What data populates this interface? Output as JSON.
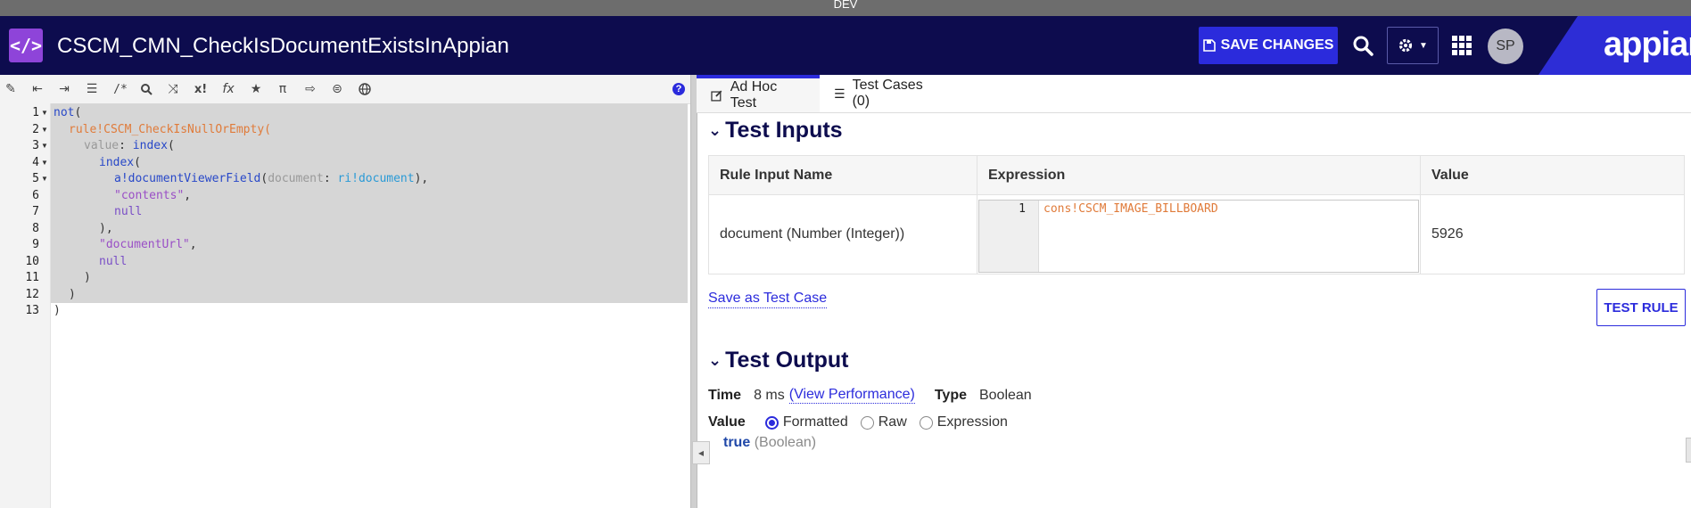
{
  "env": {
    "label": "DEV"
  },
  "header": {
    "title": "CSCM_CMN_CheckIsDocumentExistsInAppian",
    "save_label": "SAVE CHANGES",
    "avatar_initials": "SP",
    "brand": "appian"
  },
  "editor": {
    "toolbar_icons": [
      "format-icon",
      "outdent-icon",
      "indent-icon",
      "list-icon",
      "comment-icon",
      "search-icon",
      "shuffle-icon",
      "variable-icon",
      "function-icon",
      "star-icon",
      "pi-icon",
      "export-icon",
      "search-data-icon",
      "globe-icon"
    ],
    "lines": [
      {
        "n": "1",
        "fold": true
      },
      {
        "n": "2",
        "fold": true
      },
      {
        "n": "3",
        "fold": true
      },
      {
        "n": "4",
        "fold": true
      },
      {
        "n": "5",
        "fold": true
      },
      {
        "n": "6",
        "fold": false
      },
      {
        "n": "7",
        "fold": false
      },
      {
        "n": "8",
        "fold": false
      },
      {
        "n": "9",
        "fold": false
      },
      {
        "n": "10",
        "fold": false
      },
      {
        "n": "11",
        "fold": false
      },
      {
        "n": "12",
        "fold": false
      },
      {
        "n": "13",
        "fold": false
      }
    ],
    "code": {
      "l1_fn": "not",
      "l1_paren": "(",
      "l2_rule": "rule!CSCM_CheckIsNullOrEmpty",
      "l2_paren": "(",
      "l3_param": "value",
      "l3_colon": ": ",
      "l3_fn": "index",
      "l3_paren": "(",
      "l4_fn": "index",
      "l4_paren": "(",
      "l5_fn": "a!documentViewerField",
      "l5_open": "(",
      "l5_param": "document",
      "l5_colon": ": ",
      "l5_ri": "ri!document",
      "l5_close": "),",
      "l6_str": "\"contents\"",
      "l6_comma": ",",
      "l7_null": "null",
      "l8": "),",
      "l9_str": "\"documentUrl\"",
      "l9_comma": ",",
      "l10_null": "null",
      "l11": ")",
      "l12": ")",
      "l13": ")"
    }
  },
  "tabs": {
    "adhoc": "Ad Hoc Test",
    "cases": "Test Cases (0)"
  },
  "test_inputs": {
    "title": "Test Inputs",
    "headers": [
      "Rule Input Name",
      "Expression",
      "Value"
    ],
    "row": {
      "name": "document (Number (Integer))",
      "expr_line": "1",
      "expression": "cons!CSCM_IMAGE_BILLBOARD",
      "value": "5926"
    },
    "save_link": "Save as Test Case",
    "test_button": "TEST RULE"
  },
  "test_output": {
    "title": "Test Output",
    "time_label": "Time",
    "time_value": "8 ms",
    "perf_link": "(View Performance)",
    "type_label": "Type",
    "type_value": "Boolean",
    "value_label": "Value",
    "options": [
      "Formatted",
      "Raw",
      "Expression"
    ],
    "selected": "Formatted",
    "result_value": "true",
    "result_type": "(Boolean)"
  }
}
